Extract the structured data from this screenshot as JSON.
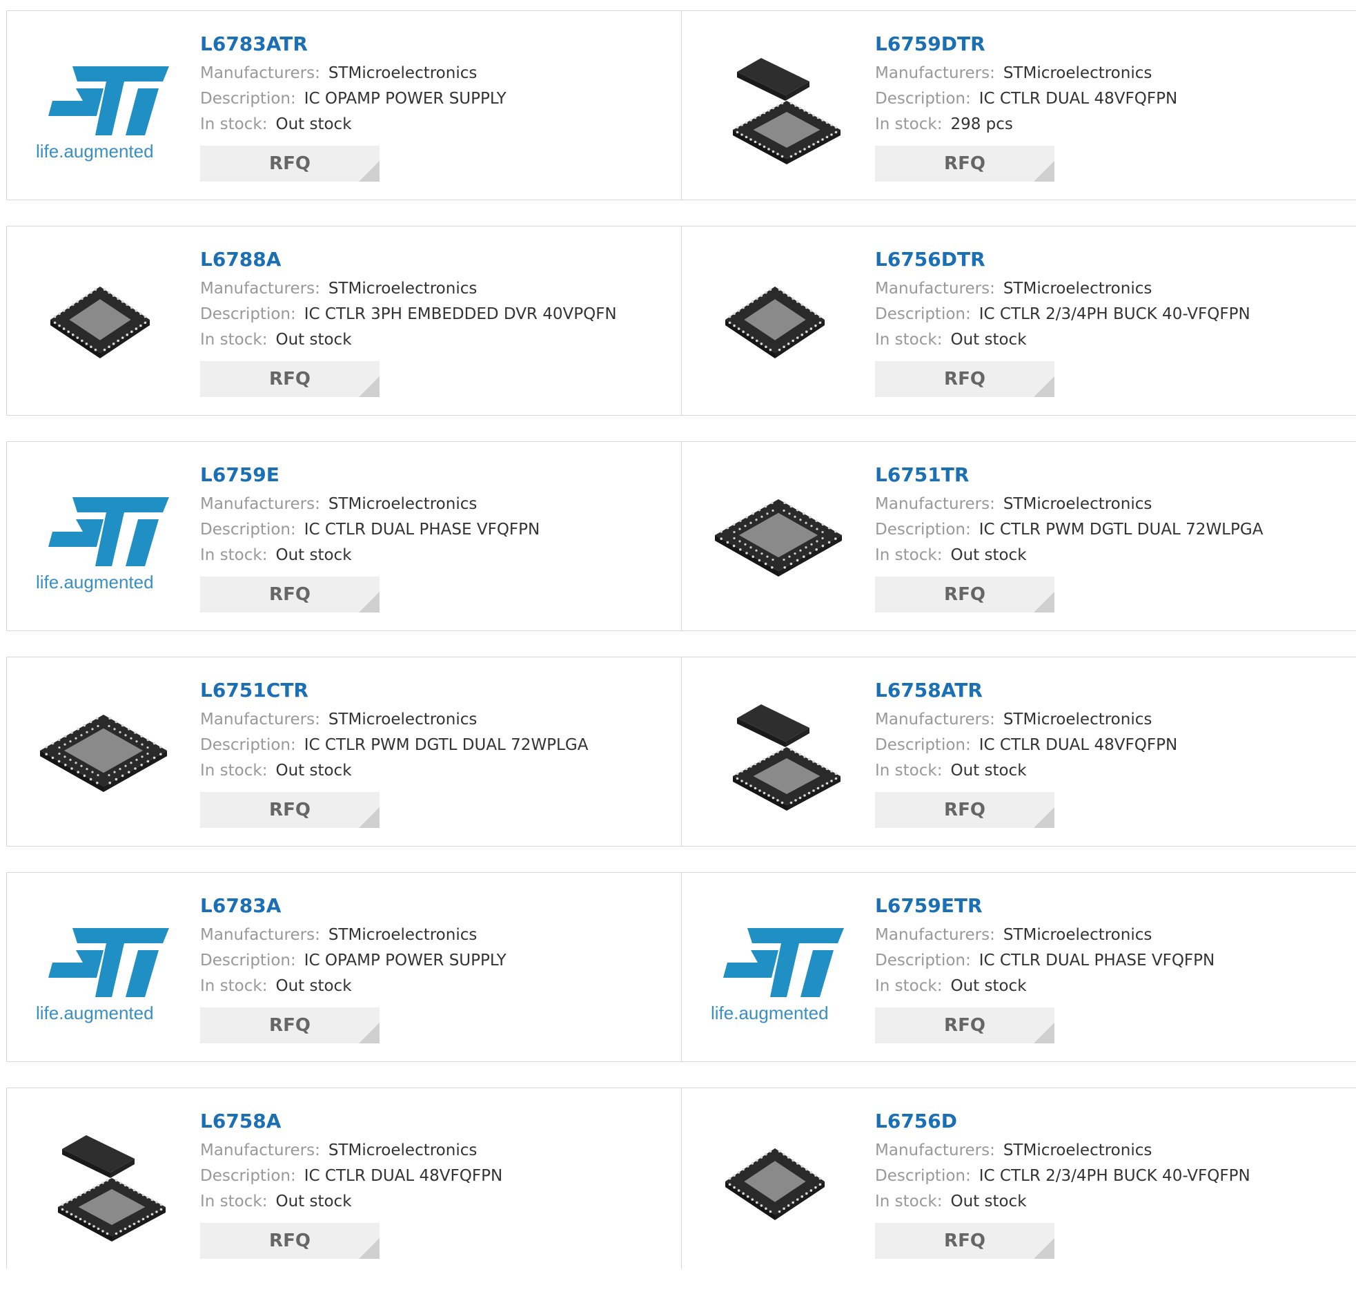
{
  "labels": {
    "manufacturers": "Manufacturers:",
    "description": "Description:",
    "in_stock": "In stock:",
    "rfq": "RFQ"
  },
  "st_logo_text": "life.augmented",
  "colors": {
    "part_number": "#1a6fb5",
    "logo_blue": "#1f8fc4",
    "label_gray": "#999999",
    "rfq_bg": "#efefef"
  },
  "products": [
    {
      "part": "L6783ATR",
      "manufacturer": "STMicroelectronics",
      "description": "IC OPAMP POWER SUPPLY",
      "stock": "Out stock",
      "image": "st-logo"
    },
    {
      "part": "L6759DTR",
      "manufacturer": "STMicroelectronics",
      "description": "IC CTLR DUAL 48VFQFPN",
      "stock": "298 pcs",
      "image": "chip-pair"
    },
    {
      "part": "L6788A",
      "manufacturer": "STMicroelectronics",
      "description": "IC CTLR 3PH EMBEDDED DVR 40VPQFN",
      "stock": "Out stock",
      "image": "chip-qfn"
    },
    {
      "part": "L6756DTR",
      "manufacturer": "STMicroelectronics",
      "description": "IC CTLR 2/3/4PH BUCK 40-VFQFPN",
      "stock": "Out stock",
      "image": "chip-qfn"
    },
    {
      "part": "L6759E",
      "manufacturer": "STMicroelectronics",
      "description": "IC CTLR DUAL PHASE VFQFPN",
      "stock": "Out stock",
      "image": "st-logo"
    },
    {
      "part": "L6751TR",
      "manufacturer": "STMicroelectronics",
      "description": "IC CTLR PWM DGTL DUAL 72WLPGA",
      "stock": "Out stock",
      "image": "chip-lga"
    },
    {
      "part": "L6751CTR",
      "manufacturer": "STMicroelectronics",
      "description": "IC CTLR PWM DGTL DUAL 72WPLGA",
      "stock": "Out stock",
      "image": "chip-lga"
    },
    {
      "part": "L6758ATR",
      "manufacturer": "STMicroelectronics",
      "description": "IC CTLR DUAL 48VFQFPN",
      "stock": "Out stock",
      "image": "chip-pair"
    },
    {
      "part": "L6783A",
      "manufacturer": "STMicroelectronics",
      "description": "IC OPAMP POWER SUPPLY",
      "stock": "Out stock",
      "image": "st-logo"
    },
    {
      "part": "L6759ETR",
      "manufacturer": "STMicroelectronics",
      "description": "IC CTLR DUAL PHASE VFQFPN",
      "stock": "Out stock",
      "image": "st-logo"
    },
    {
      "part": "L6758A",
      "manufacturer": "STMicroelectronics",
      "description": "IC CTLR DUAL 48VFQFPN",
      "stock": "Out stock",
      "image": "chip-pair"
    },
    {
      "part": "L6756D",
      "manufacturer": "STMicroelectronics",
      "description": "IC CTLR 2/3/4PH BUCK 40-VFQFPN",
      "stock": "Out stock",
      "image": "chip-qfn"
    }
  ]
}
